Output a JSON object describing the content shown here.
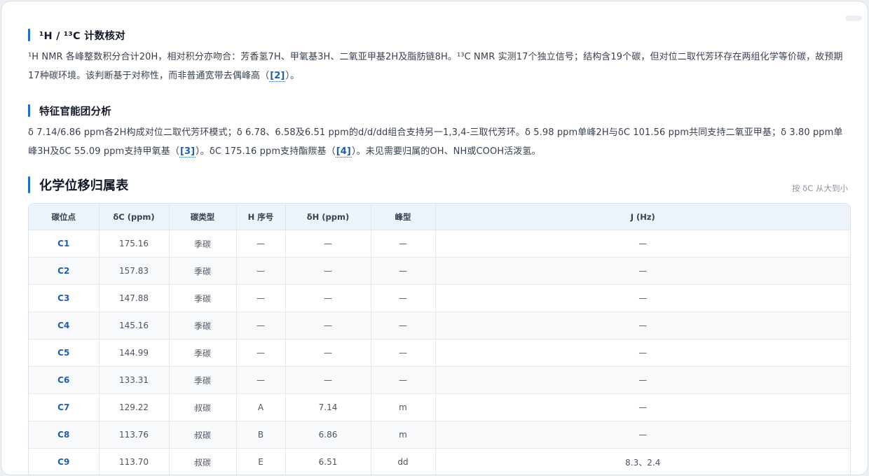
{
  "sections": {
    "count": {
      "title": "¹H / ¹³C 计数核对",
      "body_a": "¹H NMR 各峰整数积分合计20H，相对积分亦吻合：芳香氢7H、甲氧基3H、二氧亚甲基2H及脂肪链8H。¹³C NMR 实测17个独立信号；结构含19个碳，但对位二取代芳环存在两组化学等价碳，故预期17种碳环境。该判断基于对称性，而非普通宽带去偶峰高（",
      "ref_a": "[2]",
      "body_b": "）。"
    },
    "func": {
      "title": "特征官能团分析",
      "body_a": "δ 7.14/6.86 ppm各2H构成对位二取代芳环模式；δ 6.78、6.58及6.51 ppm的d/d/dd组合支持另一1,3,4-三取代芳环。δ 5.98 ppm单峰2H与δC 101.56 ppm共同支持二氧亚甲基；δ 3.80 ppm单峰3H及δC 55.09 ppm支持甲氧基（",
      "ref_a": "[3]",
      "body_b": "）。δC 175.16 ppm支持酯羰基（",
      "ref_b": "[4]",
      "body_c": "）。未见需要归属的OH、NH或COOH活泼氢。"
    },
    "table": {
      "title": "化学位移归属表",
      "sort_note": "按 δC 从大到小"
    }
  },
  "table": {
    "headers": [
      "碳位点",
      "δC (ppm)",
      "碳类型",
      "H 序号",
      "δH (ppm)",
      "峰型",
      "J (Hz)"
    ],
    "rows": [
      [
        "C1",
        "175.16",
        "季碳",
        "—",
        "—",
        "—",
        "—"
      ],
      [
        "C2",
        "157.83",
        "季碳",
        "—",
        "—",
        "—",
        "—"
      ],
      [
        "C3",
        "147.88",
        "季碳",
        "—",
        "—",
        "—",
        "—"
      ],
      [
        "C4",
        "145.16",
        "季碳",
        "—",
        "—",
        "—",
        "—"
      ],
      [
        "C5",
        "144.99",
        "季碳",
        "—",
        "—",
        "—",
        "—"
      ],
      [
        "C6",
        "133.31",
        "季碳",
        "—",
        "—",
        "—",
        "—"
      ],
      [
        "C7",
        "129.22",
        "叔碳",
        "A",
        "7.14",
        "m",
        "—"
      ],
      [
        "C8",
        "113.76",
        "叔碳",
        "B",
        "6.86",
        "m",
        "—"
      ],
      [
        "C9",
        "113.70",
        "叔碳",
        "E",
        "6.51",
        "dd",
        "8.3、2.4"
      ]
    ]
  },
  "colors": {
    "accent": "#1f6fd1",
    "link": "#1f5ea8",
    "header_bg": "#edf3fa"
  }
}
